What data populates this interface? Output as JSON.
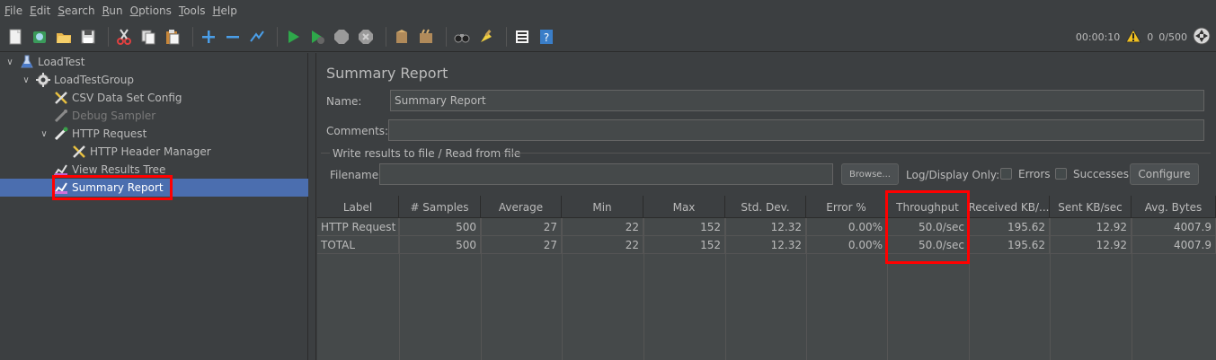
{
  "menu": [
    {
      "u": "F",
      "rest": "ile"
    },
    {
      "u": "E",
      "rest": "dit"
    },
    {
      "u": "S",
      "rest": "earch"
    },
    {
      "u": "R",
      "rest": "un"
    },
    {
      "u": "O",
      "rest": "ptions"
    },
    {
      "u": "T",
      "rest": "ools"
    },
    {
      "u": "H",
      "rest": "elp"
    }
  ],
  "status": {
    "elapsed": "00:00:10",
    "warnings": "0",
    "threads": "0/500"
  },
  "tree": {
    "root": "LoadTest",
    "group": "LoadTestGroup",
    "csv": "CSV Data Set Config",
    "debug": "Debug Sampler",
    "http": "HTTP Request",
    "header": "HTTP Header Manager",
    "results_tree": "View Results Tree",
    "summary": "Summary Report"
  },
  "panel": {
    "title": "Summary Report",
    "name_label": "Name:",
    "name_value": "Summary Report",
    "comments_label": "Comments:",
    "comments_value": "",
    "group_title": "Write results to file / Read from file",
    "filename_label": "Filename",
    "filename_value": "",
    "browse": "Browse...",
    "log_display": "Log/Display Only:",
    "errors": "Errors",
    "successes": "Successes",
    "configure": "Configure"
  },
  "table": {
    "headers": [
      "Label",
      "# Samples",
      "Average",
      "Min",
      "Max",
      "Std. Dev.",
      "Error %",
      "Throughput",
      "Received KB/...",
      "Sent KB/sec",
      "Avg. Bytes"
    ],
    "rows": [
      [
        "HTTP Request",
        "500",
        "27",
        "22",
        "152",
        "12.32",
        "0.00%",
        "50.0/sec",
        "195.62",
        "12.92",
        "4007.9"
      ],
      [
        "TOTAL",
        "500",
        "27",
        "22",
        "152",
        "12.32",
        "0.00%",
        "50.0/sec",
        "195.62",
        "12.92",
        "4007.9"
      ]
    ]
  }
}
